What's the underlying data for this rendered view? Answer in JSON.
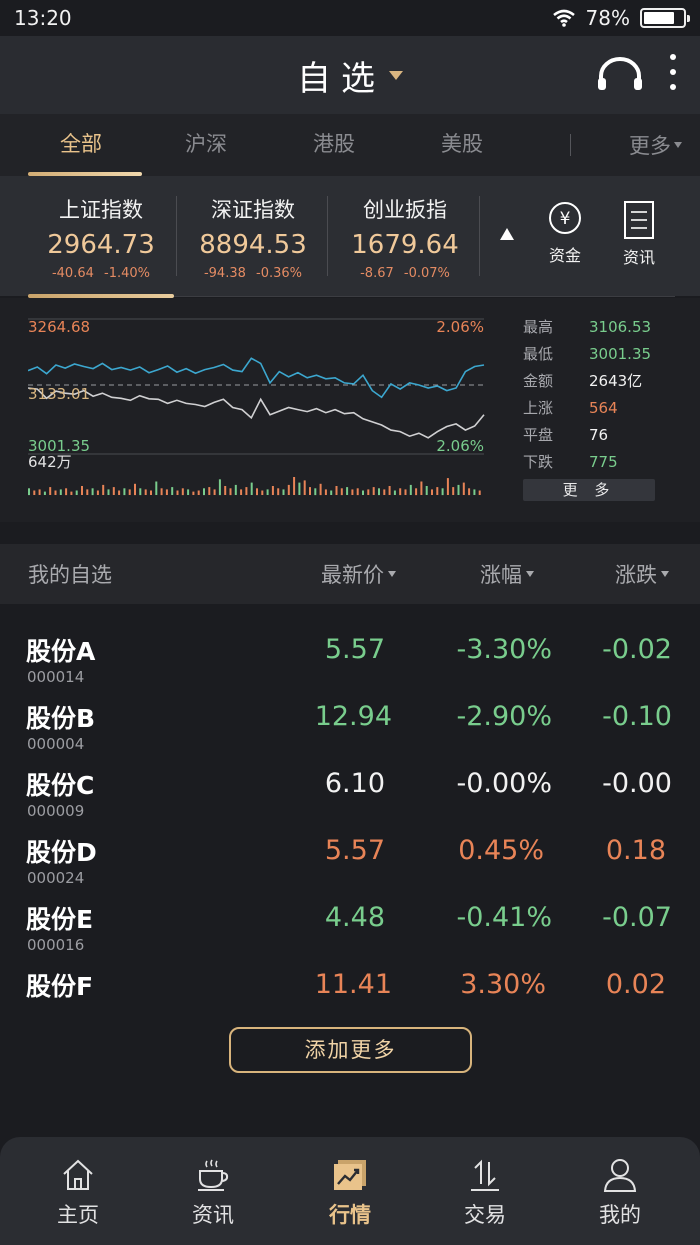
{
  "status": {
    "time": "13:20",
    "battery": "78%",
    "battery_level": 0.78
  },
  "header": {
    "title": "自选"
  },
  "tabs": [
    {
      "label": "全部",
      "active": true
    },
    {
      "label": "沪深",
      "active": false
    },
    {
      "label": "港股",
      "active": false
    },
    {
      "label": "美股",
      "active": false
    }
  ],
  "tabs_more": "更多",
  "indices": [
    {
      "name": "上证指数",
      "value": "2964.73",
      "change": "-40.64",
      "pct": "-1.40%"
    },
    {
      "name": "深证指数",
      "value": "8894.53",
      "change": "-94.38",
      "pct": "-0.36%"
    },
    {
      "name": "创业扳指",
      "value": "1679.64",
      "change": "-8.67",
      "pct": "-0.07%"
    }
  ],
  "quick": {
    "fund": "资金",
    "news": "资讯",
    "fund_glyph": "¥"
  },
  "chart": {
    "high_label": "3264.68",
    "mid_label": "3133.01",
    "low_label": "3001.35",
    "pct_top": "2.06%",
    "pct_bottom": "2.06%",
    "volume_label": "642万"
  },
  "chart_data": {
    "type": "line",
    "ylim": [
      3001.35,
      3264.68
    ],
    "baseline": 3133.01,
    "series": [
      {
        "values": [
          3164,
          3171,
          3158,
          3175,
          3169,
          3177,
          3172,
          3168,
          3178,
          3166,
          3170,
          3165,
          3171,
          3160,
          3166,
          3173,
          3161,
          3168,
          3159,
          3166,
          3170,
          3176,
          3165,
          3162,
          3188,
          3178,
          3140,
          3162,
          3152,
          3160,
          3150,
          3155,
          3148,
          3150,
          3140,
          3138,
          3155,
          3125,
          3112,
          3138,
          3128,
          3140,
          3136,
          3130,
          3134,
          3125,
          3130,
          3162,
          3172,
          3175
        ]
      },
      {
        "values": [
          3130,
          3128,
          3110,
          3124,
          3120,
          3118,
          3125,
          3114,
          3120,
          3112,
          3110,
          3106,
          3115,
          3109,
          3108,
          3100,
          3106,
          3100,
          3098,
          3094,
          3102,
          3108,
          3092,
          3088,
          3072,
          3108,
          3078,
          3085,
          3092,
          3088,
          3084,
          3090,
          3082,
          3088,
          3080,
          3082,
          3070,
          3064,
          3058,
          3048,
          3045,
          3036,
          3042,
          3033,
          3045,
          3055,
          3060,
          3048,
          3056,
          3078
        ]
      }
    ],
    "volume": [
      6,
      4,
      5,
      3,
      7,
      4,
      5,
      6,
      3,
      4,
      8,
      5,
      6,
      4,
      9,
      5,
      7,
      4,
      6,
      5,
      10,
      6,
      5,
      4,
      12,
      6,
      5,
      7,
      4,
      6,
      5,
      3,
      4,
      6,
      7,
      5,
      14,
      8,
      6,
      9,
      5,
      7,
      11,
      6,
      4,
      5,
      8,
      6,
      5,
      9,
      16,
      11,
      13,
      7,
      6,
      10,
      5,
      4,
      8,
      6,
      7,
      5,
      6,
      4,
      5,
      7,
      6,
      5,
      8,
      4,
      6,
      5,
      9,
      6,
      12,
      8,
      5,
      7,
      6,
      15,
      7,
      9,
      11,
      6,
      5,
      4
    ]
  },
  "stats": [
    {
      "key": "最高",
      "value": "3106.53",
      "color": "#79cd8d"
    },
    {
      "key": "最低",
      "value": "3001.35",
      "color": "#79cd8d"
    },
    {
      "key": "金额",
      "value": "2643亿",
      "color": "#f2f2f2"
    },
    {
      "key": "上涨",
      "value": "564",
      "color": "#e88457"
    },
    {
      "key": "平盘",
      "value": "76",
      "color": "#f2f2f2"
    },
    {
      "key": "下跌",
      "value": "775",
      "color": "#79cd8d"
    }
  ],
  "stats_more": "更 多",
  "watchlist": {
    "title": "我的自选",
    "col_price": "最新价",
    "col_pct": "涨幅",
    "col_change": "涨跌",
    "rows": [
      {
        "name": "股份A",
        "code": "000014",
        "price": "5.57",
        "pct": "-3.30%",
        "change": "-0.02",
        "trend": "down"
      },
      {
        "name": "股份B",
        "code": "000004",
        "price": "12.94",
        "pct": "-2.90%",
        "change": "-0.10",
        "trend": "down"
      },
      {
        "name": "股份C",
        "code": "000009",
        "price": "6.10",
        "pct": "-0.00%",
        "change": "-0.00",
        "trend": "flat"
      },
      {
        "name": "股份D",
        "code": "000024",
        "price": "5.57",
        "pct": "0.45%",
        "change": "0.18",
        "trend": "up"
      },
      {
        "name": "股份E",
        "code": "000016",
        "price": "4.48",
        "pct": "-0.41%",
        "change": "-0.07",
        "trend": "down"
      },
      {
        "name": "股份F",
        "code": "",
        "price": "11.41",
        "pct": "3.30%",
        "change": "0.02",
        "trend": "up"
      }
    ],
    "add_more": "添加更多"
  },
  "colors": {
    "up": "#e88457",
    "down": "#79cd8d",
    "flat": "#f2f2f2",
    "accent": "#e9c38b"
  },
  "nav": [
    {
      "label": "主页",
      "icon": "home-icon",
      "active": false
    },
    {
      "label": "资讯",
      "icon": "coffee-icon",
      "active": false
    },
    {
      "label": "行情",
      "icon": "chart-icon",
      "active": true
    },
    {
      "label": "交易",
      "icon": "trade-arrows-icon",
      "active": false
    },
    {
      "label": "我的",
      "icon": "user-icon",
      "active": false
    }
  ]
}
